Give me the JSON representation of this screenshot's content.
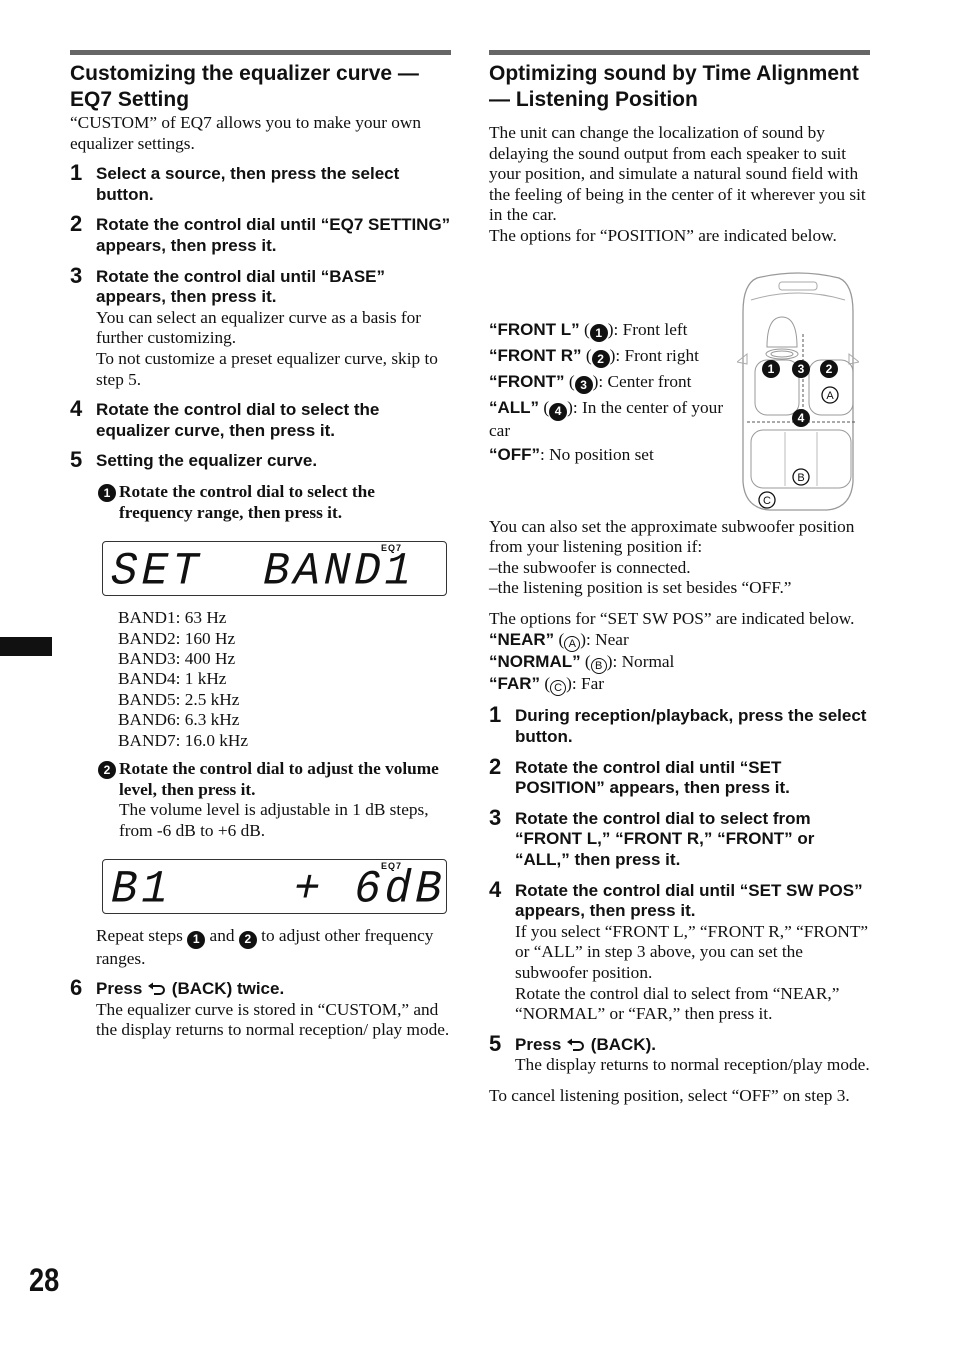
{
  "left": {
    "title": "Customizing the equalizer curve — EQ7 Setting",
    "intro": "“CUSTOM” of EQ7 allows you to make your own equalizer settings.",
    "steps": [
      {
        "num": "1",
        "title": "Select a source, then press the select button."
      },
      {
        "num": "2",
        "title": "Rotate the control dial until “EQ7 SETTING” appears, then press it."
      },
      {
        "num": "3",
        "title": "Rotate the control dial until “BASE” appears, then press it.",
        "body": "You can select an equalizer curve as a basis for further customizing.",
        "body2": "To not customize a preset equalizer curve, skip to step 5."
      },
      {
        "num": "4",
        "title": "Rotate the control dial to select the equalizer curve, then press it."
      },
      {
        "num": "5",
        "title": "Setting the equalizer curve."
      },
      {
        "num": "6",
        "title_pre": "Press",
        "title_post": "(BACK) twice.",
        "body": "The equalizer curve is stored in “CUSTOM,” and the display returns to normal reception/ play mode."
      }
    ],
    "substeps": [
      {
        "num": "1",
        "title": "Rotate the control dial to select the frequency range, then press it."
      },
      {
        "num": "2",
        "title": "Rotate the control dial to adjust the volume level, then press it.",
        "body": "The volume level is adjustable in 1 dB steps, from -6 dB to +6 dB."
      }
    ],
    "lcd1": {
      "text": "SET  BAND1",
      "indicator": "EQ7"
    },
    "lcd2": {
      "text": "B1    + 6dB",
      "indicator": "EQ7"
    },
    "bands": [
      "BAND1: 63 Hz",
      "BAND2: 160 Hz",
      "BAND3: 400 Hz",
      "BAND4: 1 kHz",
      "BAND5: 2.5 kHz",
      "BAND6: 6.3 kHz",
      "BAND7: 16.0 kHz"
    ],
    "repeat": {
      "pre": "Repeat steps",
      "mid": "and",
      "post": "to adjust other frequency ranges.",
      "c1": "1",
      "c2": "2"
    }
  },
  "right": {
    "title": "Optimizing sound by Time Alignment — Listening Position",
    "intro": "The unit can change the localization of sound by delaying the sound output from each speaker to suit your position, and simulate a natural sound field with the feeling of being in the center of it wherever you sit in the car.",
    "intro2": "The options for “POSITION” are indicated below.",
    "positions": [
      {
        "label": "“FRONT L”",
        "mark": "1",
        "desc": ": Front left"
      },
      {
        "label": "“FRONT R”",
        "mark": "2",
        "desc": ": Front right"
      },
      {
        "label": "“FRONT”",
        "mark": "3",
        "desc": ": Center front"
      },
      {
        "label": "“ALL”",
        "mark": "4",
        "desc": ": In the center of your car"
      },
      {
        "label": "“OFF”",
        "mark": "",
        "desc": ": No position set"
      }
    ],
    "diagram": {
      "marks": [
        "1",
        "3",
        "2",
        "A",
        "4",
        "B",
        "C"
      ]
    },
    "sub_intro": "You can also set the approximate subwoofer position from your listening position if:",
    "conditions": [
      "the subwoofer is connected.",
      "the listening position is set besides “OFF.”"
    ],
    "sw_intro": "The options for “SET SW POS” are indicated below.",
    "sw_positions": [
      {
        "label": "“NEAR”",
        "mark": "A",
        "desc": ": Near"
      },
      {
        "label": "“NORMAL”",
        "mark": "B",
        "desc": ": Normal"
      },
      {
        "label": "“FAR”",
        "mark": "C",
        "desc": ": Far"
      }
    ],
    "steps": [
      {
        "num": "1",
        "title": "During reception/playback, press the select button."
      },
      {
        "num": "2",
        "title": "Rotate the control dial until “SET POSITION” appears, then press it."
      },
      {
        "num": "3",
        "title": "Rotate the control dial to select from “FRONT L,” “FRONT R,” “FRONT” or “ALL,” then press it."
      },
      {
        "num": "4",
        "title": "Rotate the control dial until “SET SW POS” appears, then press it.",
        "body": "If you select “FRONT L,” “FRONT R,” “FRONT” or “ALL” in step 3 above, you can set the subwoofer position.",
        "body2": "Rotate the control dial to select from “NEAR,” “NORMAL” or “FAR,” then press it."
      },
      {
        "num": "5",
        "title_pre": "Press",
        "title_post": "(BACK).",
        "body": "The display returns to normal reception/play mode."
      }
    ],
    "outro": "To cancel listening position, select “OFF” on step 3."
  },
  "page_number": "28"
}
